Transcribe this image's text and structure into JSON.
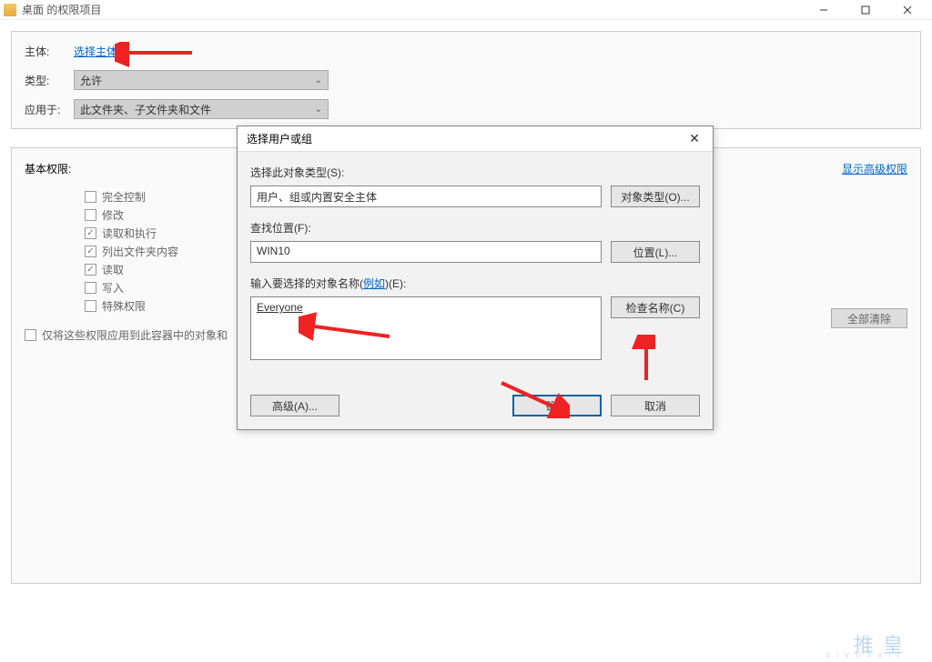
{
  "main": {
    "title": "桌面 的权限项目"
  },
  "top_form": {
    "principal_label": "主体:",
    "select_principal": "选择主体",
    "type_label": "类型:",
    "type_value": "允许",
    "applies_label": "应用于:",
    "applies_value": "此文件夹、子文件夹和文件"
  },
  "permissions": {
    "header": "基本权限:",
    "advanced_link": "显示高级权限",
    "items": [
      {
        "label": "完全控制",
        "checked": false
      },
      {
        "label": "修改",
        "checked": false
      },
      {
        "label": "读取和执行",
        "checked": true
      },
      {
        "label": "列出文件夹内容",
        "checked": true
      },
      {
        "label": "读取",
        "checked": true
      },
      {
        "label": "写入",
        "checked": false
      },
      {
        "label": "特殊权限",
        "checked": false
      }
    ],
    "apply_only": "仅将这些权限应用到此容器中的对象和",
    "clear_all": "全部清除"
  },
  "dialog": {
    "title": "选择用户或组",
    "object_type_label": "选择此对象类型(S):",
    "object_type_value": "用户、组或内置安全主体",
    "object_type_btn": "对象类型(O)...",
    "location_label": "查找位置(F):",
    "location_value": "WIN10",
    "location_btn": "位置(L)...",
    "names_label_prefix": "输入要选择的对象名称(",
    "names_label_link": "例如",
    "names_label_suffix": ")(E):",
    "names_value": "Everyone",
    "check_btn": "检查名称(C)",
    "advanced_btn": "高级(A)...",
    "ok_btn": "确定",
    "cancel_btn": "取消"
  },
  "watermark": {
    "main": "推 皇",
    "sub": "a i y u n x i t"
  }
}
